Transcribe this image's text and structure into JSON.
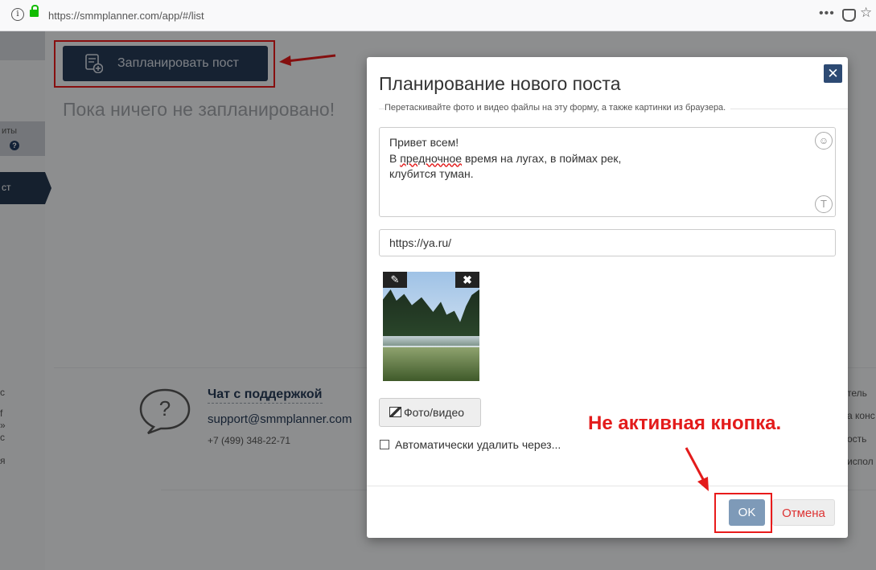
{
  "browser": {
    "url": "https://smmplanner.com/app/#/list"
  },
  "sidebar": {
    "item1_label": "иты",
    "item2_label": "ст"
  },
  "toolbar": {
    "schedule_label": "Запланировать пост"
  },
  "main": {
    "empty_text": "Пока ничего не запланировано!"
  },
  "footer": {
    "support_title": "Чат с поддержкой",
    "support_email": "support@smmplanner.com",
    "support_phone": "+7 (499) 348-22-71",
    "left_fragments": [
      "с",
      "f",
      "»",
      "с",
      "я"
    ],
    "right_fragments": [
      "тель",
      "а конс",
      "ость",
      "испол"
    ]
  },
  "modal": {
    "title": "Планирование нового поста",
    "hint": "Перетаскивайте фото и видео файлы на эту форму, а также картинки из браузера.",
    "post_line1": "Привет всем!",
    "post_line2_a": "В ",
    "post_line2_spell": "предночное",
    "post_line2_b": " время на лугах, в поймах рек,",
    "post_line3": "клубится туман.",
    "link_value": "https://ya.ru/",
    "media_button": "Фото/видео",
    "auto_delete_label": "Автоматически удалить через...",
    "ok_label": "OK",
    "cancel_label": "Отмена",
    "close_label": "✕"
  },
  "annotation": {
    "text": "Не активная кнопка."
  },
  "colors": {
    "accent": "#263b57",
    "annotation": "#e31b1b",
    "ok_disabled": "#7e9ab8"
  }
}
